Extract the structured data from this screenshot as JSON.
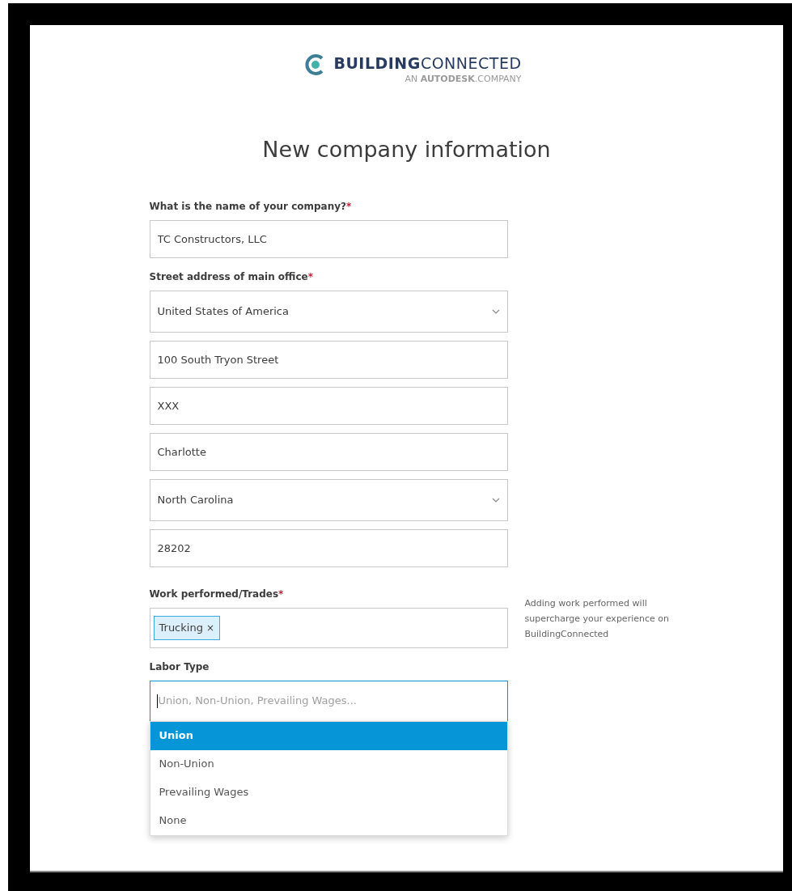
{
  "logo": {
    "brand_bold": "BUILDING",
    "brand_light": "CONNECTED",
    "tagline_pre": "AN",
    "tagline_bold": "AUTODESK",
    "tagline_post": ".COMPANY"
  },
  "heading": "New company information",
  "sections": [
    {
      "label": "What is the name of your company?",
      "required_mark": "*",
      "fields": [
        {
          "kind": "text",
          "value": "TC Constructors, LLC"
        }
      ]
    },
    {
      "label": "Street address of main office",
      "required_mark": "*",
      "fields": [
        {
          "kind": "select",
          "value": "United States of America"
        },
        {
          "kind": "text",
          "value": "100 South Tryon Street"
        },
        {
          "kind": "text",
          "value": "XXX"
        },
        {
          "kind": "text",
          "value": "Charlotte"
        },
        {
          "kind": "select",
          "value": "North Carolina"
        },
        {
          "kind": "text",
          "value": "28202"
        }
      ]
    },
    {
      "label": "Work performed/Trades",
      "required_mark": "*",
      "hint": "Adding work performed will supercharge your experience on BuildingConnected",
      "fields": [
        {
          "kind": "tags",
          "tags": [
            {
              "label": "Trucking",
              "remove": "×"
            }
          ]
        }
      ]
    },
    {
      "label": "Labor Type",
      "fields": [
        {
          "kind": "combobox",
          "placeholder": "Union, Non-Union, Prevailing Wages...",
          "options": [
            {
              "label": "Union",
              "selected": true
            },
            {
              "label": "Non-Union",
              "selected": false
            },
            {
              "label": "Prevailing Wages",
              "selected": false
            },
            {
              "label": "None",
              "selected": false
            }
          ]
        }
      ]
    }
  ]
}
